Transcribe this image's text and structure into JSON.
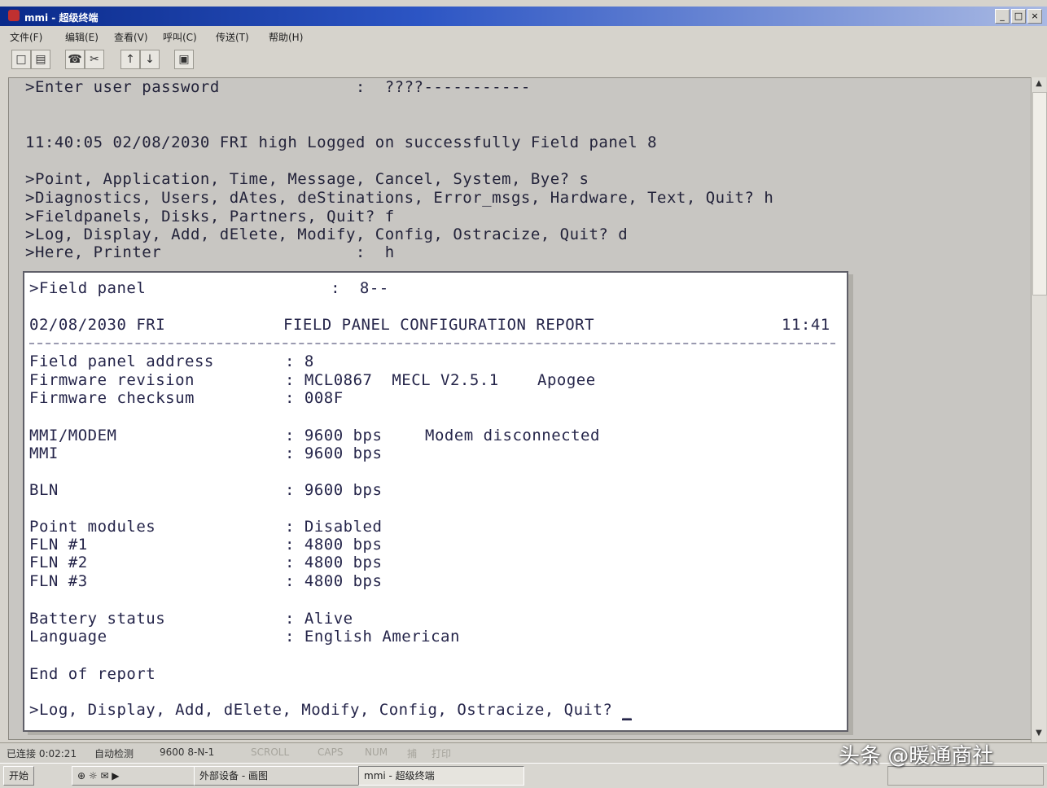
{
  "window": {
    "title": "mmi - 超级终端",
    "buttons": [
      "_",
      "□",
      "×"
    ]
  },
  "menu": [
    "文件(F)",
    "编辑(E)",
    "查看(V)",
    "呼叫(C)",
    "传送(T)",
    "帮助(H)"
  ],
  "toolbar": {
    "icons": [
      "new-icon",
      "open-icon",
      "connect-icon",
      "disconnect-icon",
      "send-icon",
      "receive-icon",
      "properties-icon"
    ]
  },
  "terminal": {
    "lines": [
      ">Enter user password              :  ????-----------",
      "11:40:05 02/08/2030 FRI high Logged on successfully Field panel 8",
      ">Point, Application, Time, Message, Cancel, System, Bye? s",
      ">Diagnostics, Users, dAtes, deStinations, Error_msgs, Hardware, Text, Quit? h",
      ">Fieldpanels, Disks, Partners, Quit? f",
      ">Log, Display, Add, dElete, Modify, Config, Ostracize, Quit? d",
      ">Here, Printer                    :  h"
    ]
  },
  "report": {
    "prompt": ">Field panel                   :  8--",
    "date": "02/08/2030 FRI",
    "title": "FIELD PANEL CONFIGURATION REPORT",
    "time": "11:41",
    "rows": [
      [
        "Field panel address",
        ": 8",
        ""
      ],
      [
        "Firmware revision",
        ": MCL0867  MECL V2.5.1",
        "Apogee"
      ],
      [
        "Firmware checksum",
        ": 008F",
        ""
      ],
      [
        "MMI/MODEM",
        ": 9600 bps",
        "Modem disconnected"
      ],
      [
        "MMI",
        ": 9600 bps",
        ""
      ],
      [
        "BLN",
        ": 9600 bps",
        ""
      ],
      [
        "Point modules",
        ": Disabled",
        ""
      ],
      [
        "FLN #1",
        ": 4800 bps",
        ""
      ],
      [
        "FLN #2",
        ": 4800 bps",
        ""
      ],
      [
        "FLN #3",
        ": 4800 bps",
        ""
      ],
      [
        "Battery status",
        ": Alive",
        ""
      ],
      [
        "Language",
        ": English American",
        ""
      ]
    ],
    "end": "End of report",
    "final_prompt": ">Log, Display, Add, dElete, Modify, Config, Ostracize, Quit? ",
    "cursor": "_"
  },
  "statusbar": [
    "已连接 0:02:21",
    "自动检测",
    "9600 8-N-1",
    "SCROLL",
    "CAPS",
    "NUM",
    "捕",
    "打印"
  ],
  "taskbar": {
    "start": "开始",
    "items": [
      "外部设备 - 画图",
      "mmi - 超级终端"
    ]
  },
  "watermark": "头条 @暖通商社"
}
